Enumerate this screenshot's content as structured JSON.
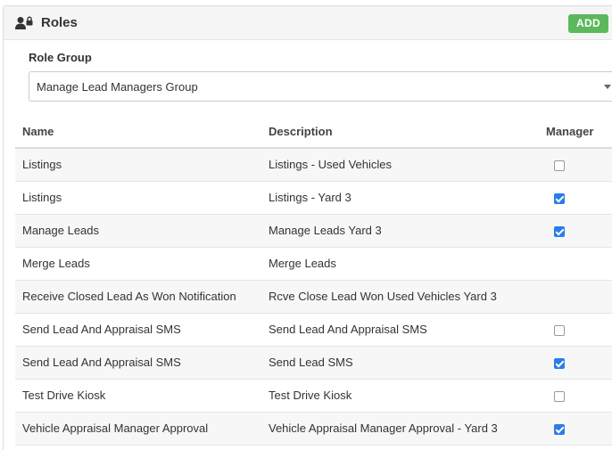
{
  "panel": {
    "title": "Roles",
    "add_label": "ADD",
    "icon": "user-lock-icon"
  },
  "role_group": {
    "label": "Role Group",
    "selected": "Manage Lead Managers Group"
  },
  "table": {
    "headers": {
      "name": "Name",
      "description": "Description",
      "manager": "Manager"
    },
    "rows": [
      {
        "name": "Listings",
        "description": "Listings - Used Vehicles",
        "manager": "unchecked"
      },
      {
        "name": "Listings",
        "description": "Listings - Yard 3",
        "manager": "checked"
      },
      {
        "name": "Manage Leads",
        "description": "Manage Leads Yard 3",
        "manager": "checked"
      },
      {
        "name": "Merge Leads",
        "description": "Merge Leads",
        "manager": "none"
      },
      {
        "name": "Receive Closed Lead As Won Notification",
        "description": "Rcve Close Lead Won Used Vehicles Yard 3",
        "manager": "none"
      },
      {
        "name": "Send Lead And Appraisal SMS",
        "description": "Send Lead And Appraisal SMS",
        "manager": "unchecked"
      },
      {
        "name": "Send Lead And Appraisal SMS",
        "description": "Send Lead SMS",
        "manager": "checked"
      },
      {
        "name": "Test Drive Kiosk",
        "description": "Test Drive Kiosk",
        "manager": "unchecked"
      },
      {
        "name": "Vehicle Appraisal Manager Approval",
        "description": "Vehicle Appraisal Manager Approval - Yard 3",
        "manager": "checked"
      }
    ]
  },
  "colors": {
    "accent_add": "#5cb85c",
    "checkbox_checked": "#2b7de9",
    "header_bg": "#f5f5f5",
    "row_stripe": "#f7f7f7"
  }
}
